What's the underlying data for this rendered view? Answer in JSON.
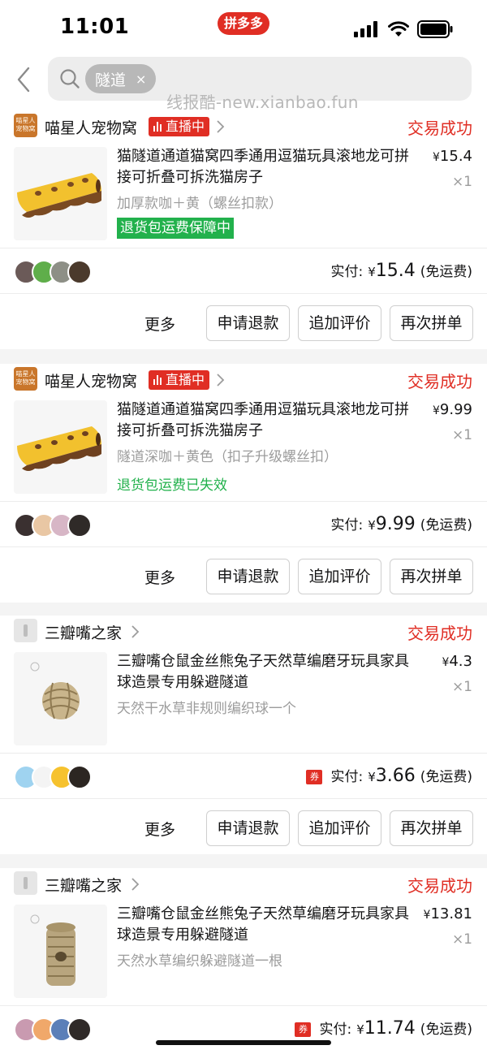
{
  "status_bar": {
    "time": "11:01",
    "app_badge": "拼多多"
  },
  "search": {
    "chip": "隧道",
    "chip_close": "×",
    "watermark": "线报酷-new.xianbao.fun"
  },
  "orders": [
    {
      "shop_name": "喵星人宠物窝",
      "shop_logo_text": "喵星人宠物窝",
      "live_tag": "直播中",
      "status": "交易成功",
      "title": "猫隧道通道猫窝四季通用逗猫玩具滚地龙可拼接可折叠可拆洗猫房子",
      "price": "15.4",
      "qty": "×1",
      "spec": "加厚款咖＋黄（螺丝扣款）",
      "guarantee": "退货包运费保障中",
      "paid_label": "实付:",
      "paid_amount": "15.4",
      "paid_note": "(免运费)",
      "actions": {
        "more": "更多",
        "refund": "申请退款",
        "review": "追加评价",
        "rebuy": "再次拼单"
      }
    },
    {
      "shop_name": "喵星人宠物窝",
      "shop_logo_text": "喵星人宠物窝",
      "live_tag": "直播中",
      "status": "交易成功",
      "title": "猫隧道通道猫窝四季通用逗猫玩具滚地龙可拼接可折叠可拆洗猫房子",
      "price": "9.99",
      "qty": "×1",
      "spec": "隧道深咖＋黄色（扣子升级螺丝扣）",
      "guarantee": "退货包运费已失效",
      "paid_label": "实付:",
      "paid_amount": "9.99",
      "paid_note": "(免运费)",
      "actions": {
        "more": "更多",
        "refund": "申请退款",
        "review": "追加评价",
        "rebuy": "再次拼单"
      }
    },
    {
      "shop_name": "三瓣嘴之家",
      "status": "交易成功",
      "title": "三瓣嘴仓鼠金丝熊兔子天然草编磨牙玩具家具球造景专用躲避隧道",
      "price": "4.3",
      "qty": "×1",
      "spec": "天然干水草非规则编织球一个",
      "coupon": "券",
      "paid_label": "实付:",
      "paid_amount": "3.66",
      "paid_note": "(免运费)",
      "actions": {
        "more": "更多",
        "refund": "申请退款",
        "review": "追加评价",
        "rebuy": "再次拼单"
      }
    },
    {
      "shop_name": "三瓣嘴之家",
      "status": "交易成功",
      "title": "三瓣嘴仓鼠金丝熊兔子天然草编磨牙玩具家具球造景专用躲避隧道",
      "price": "13.81",
      "qty": "×1",
      "spec": "天然水草编织躲避隧道一根",
      "coupon": "券",
      "paid_label": "实付:",
      "paid_amount": "11.74",
      "paid_note": "(免运费)"
    }
  ],
  "currency": "¥",
  "colors": {
    "brand_red": "#e02e24",
    "guarantee_green": "#22b14c",
    "muted_gray": "#9c9c9c"
  }
}
